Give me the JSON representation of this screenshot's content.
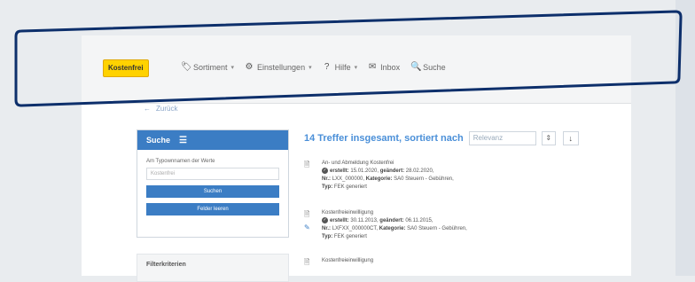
{
  "navbar": {
    "brand": "Kostenfrei",
    "items": [
      {
        "icon": "tag-icon",
        "glyph": "🏷",
        "label": "Sortiment",
        "caret": "▾"
      },
      {
        "icon": "gear-icon",
        "glyph": "⚙",
        "label": "Einstellungen",
        "caret": "▾"
      },
      {
        "icon": "help-icon",
        "glyph": "?",
        "label": "Hilfe",
        "caret": "▾"
      },
      {
        "icon": "inbox-icon",
        "glyph": "✉",
        "label": "Inbox",
        "caret": ""
      },
      {
        "icon": "search-icon",
        "glyph": "🔍",
        "label": "Suche",
        "caret": ""
      }
    ]
  },
  "backlink": {
    "arrow": "←",
    "label": "Zurück"
  },
  "search_panel": {
    "title": "Suche",
    "menu_glyph": "☰",
    "label": "Am Typownnamen der Werte",
    "input_value": "Kostenfrei",
    "search_button": "Suchen",
    "reset_button": "Felder leeren"
  },
  "filter": {
    "title": "Filterkriterien"
  },
  "results": {
    "title": "14 Treffer insgesamt, sortiert nach",
    "sort_value": "Relevanz",
    "sort_arrow": "⇕",
    "sort_dir": "↓",
    "items": [
      {
        "line1": "An- und Abmeldung Kostenfrei",
        "created_label": "erstellt:",
        "created": "15.01.2020,",
        "changed_label": "geändert:",
        "changed": "28.02.2020,",
        "nr_label": "Nr.:",
        "nr": "LXX_000000,",
        "cat_label": "Kategorie:",
        "cat": "SA0 Steuern - Gebühren,",
        "type_label": "Typ:",
        "type": "FEK generiert"
      },
      {
        "line1": "Kostenfreieinwilligung",
        "created_label": "erstellt:",
        "created": "30.11.2013,",
        "changed_label": "geändert:",
        "changed": "06.11.2015,",
        "nr_label": "Nr.:",
        "nr": "LXFXX_000000CT,",
        "cat_label": "Kategorie:",
        "cat": "SA0 Steuern - Gebühren,",
        "type_label": "Typ:",
        "type": "FEK generiert"
      },
      {
        "line1": "Kostenfreieinwilligung",
        "created_label": "",
        "created": "",
        "changed_label": "",
        "changed": "",
        "nr_label": "",
        "nr": "",
        "cat_label": "",
        "cat": "",
        "type_label": "",
        "type": ""
      }
    ]
  },
  "colors": {
    "accent": "#3b7dc4",
    "brand_bg": "#ffd200",
    "highlight": "#0d2f6b"
  }
}
